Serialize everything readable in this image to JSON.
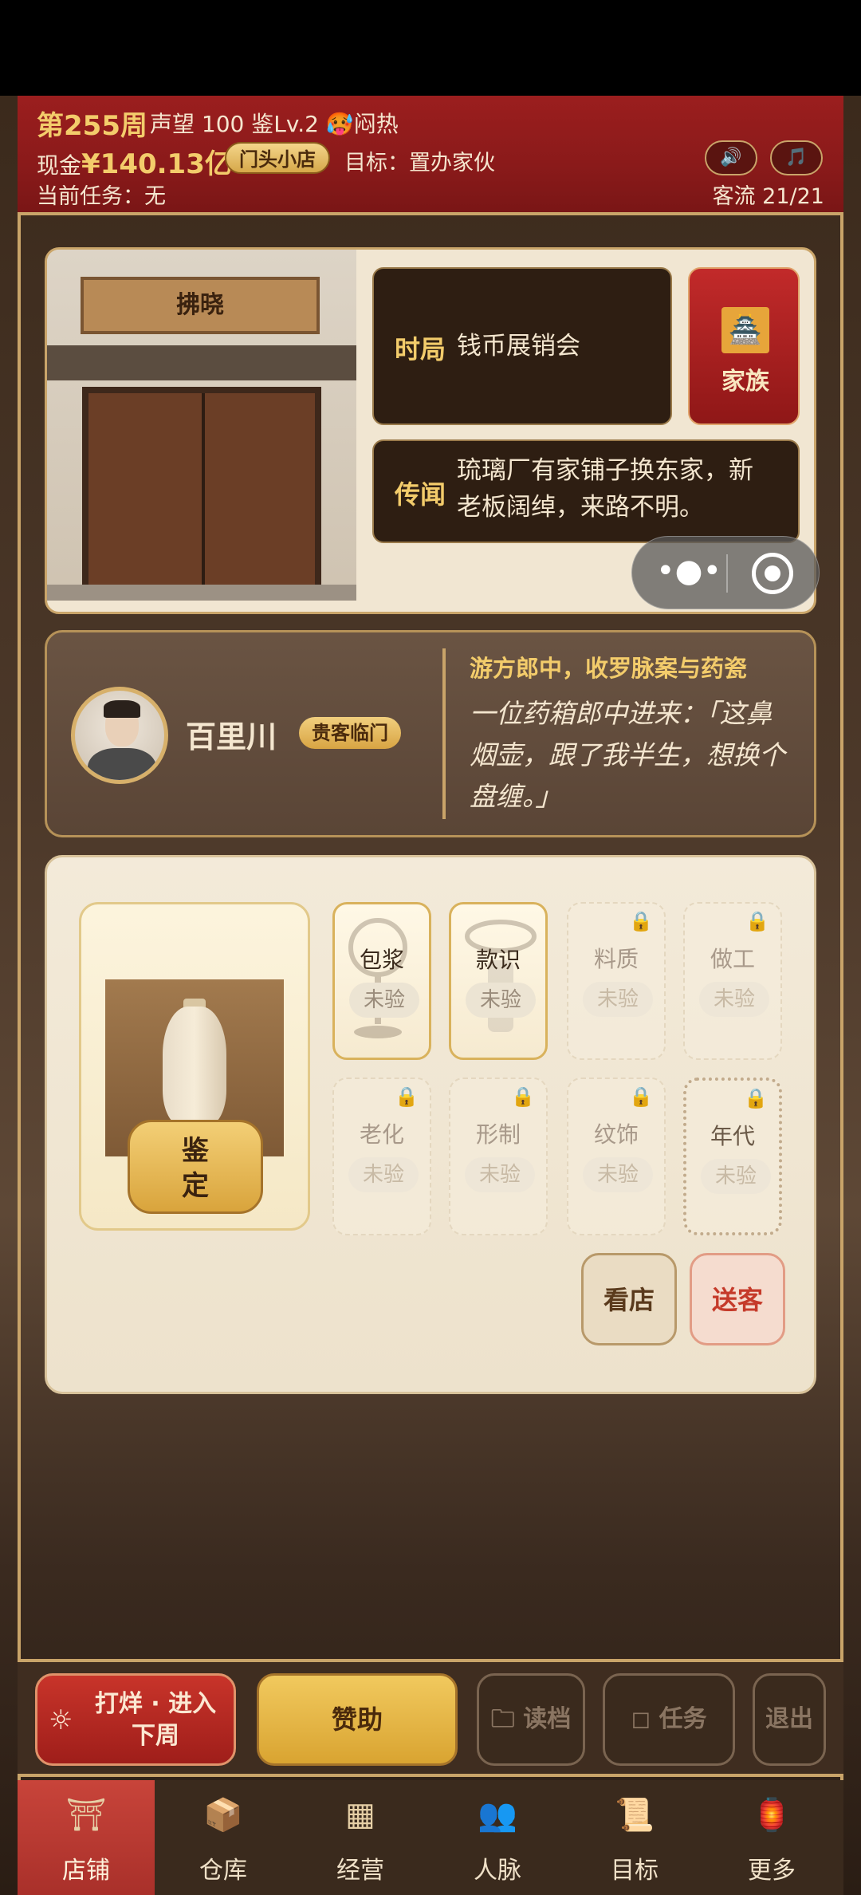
{
  "header": {
    "week": "第255周",
    "stats": "声望 100  鉴Lv.2 🥵闷热",
    "cash_label": "现金",
    "cash_value": "¥140.13亿",
    "shop_level": "门头小店",
    "goal": "目标：置办家伙",
    "task": "当前任务：无",
    "traffic": "客流 21/21",
    "sound_icon": "🔊",
    "music_icon": "🎵"
  },
  "shop": {
    "sign": "拂晓",
    "situation_label": "时局",
    "situation_text": "钱币展销会",
    "rumor_label": "传闻",
    "rumor_text": "琉璃厂有家铺子换东家，新老板阔绰，来路不明。",
    "family_label": "家族",
    "family_icon": "🏯"
  },
  "customer": {
    "name": "百里川",
    "badge": "贵客临门",
    "title": "游方郎中，收罗脉案与药瓷",
    "quote": "一位药箱郎中进来：「这鼻烟壶，跟了我半生，想换个盘缠。」"
  },
  "appraisal": {
    "appraise_label": "鉴\n定",
    "slots": [
      {
        "name": "包浆",
        "status": "未验",
        "locked": false
      },
      {
        "name": "款识",
        "status": "未验",
        "locked": false
      },
      {
        "name": "料质",
        "status": "未验",
        "locked": true
      },
      {
        "name": "做工",
        "status": "未验",
        "locked": true
      },
      {
        "name": "老化",
        "status": "未验",
        "locked": true
      },
      {
        "name": "形制",
        "status": "未验",
        "locked": true
      },
      {
        "name": "纹饰",
        "status": "未验",
        "locked": true
      },
      {
        "name": "年代",
        "status": "未验",
        "locked": true
      }
    ],
    "look_label": "看店",
    "send_label": "送客"
  },
  "actions": {
    "next_label": "打烊 · 进入下周",
    "sponsor_label": "赞助",
    "load_label": "读档",
    "task_label": "任务",
    "exit_label": "退出"
  },
  "tabs": [
    {
      "label": "店铺",
      "icon": "shop-icon"
    },
    {
      "label": "仓库",
      "icon": "warehouse-icon"
    },
    {
      "label": "经营",
      "icon": "abacus-icon"
    },
    {
      "label": "人脉",
      "icon": "people-icon"
    },
    {
      "label": "目标",
      "icon": "scroll-icon"
    },
    {
      "label": "更多",
      "icon": "more-icon"
    }
  ],
  "colors": {
    "header_red": "#9b1e1e",
    "gold": "#f3cc6b",
    "active_tab": "#c8443a"
  }
}
